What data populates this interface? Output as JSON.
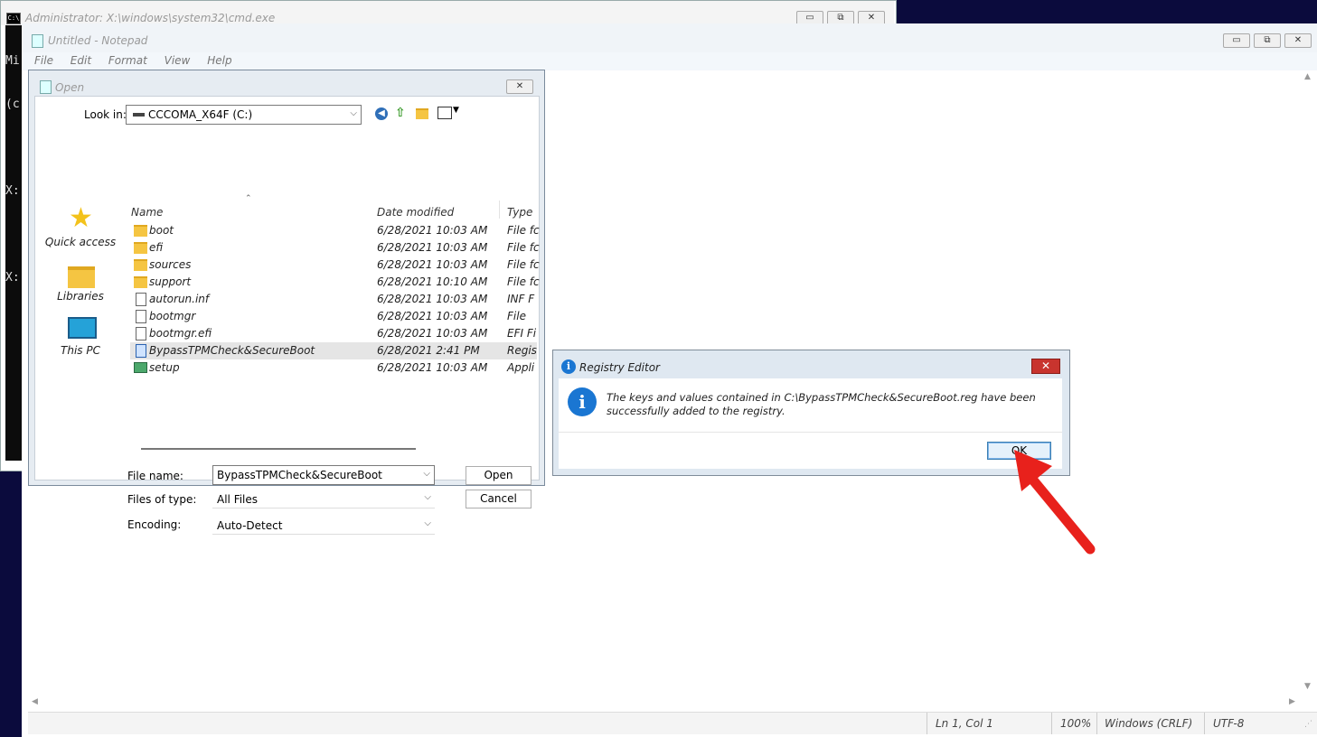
{
  "cmd": {
    "title": "Administrator: X:\\windows\\system32\\cmd.exe",
    "icon_text": "C:\\",
    "console_lines": [
      "Mi",
      "(c",
      "",
      "X:",
      "",
      "X:"
    ],
    "buttons": {
      "minimize": "▭",
      "restore": "⧉",
      "close": "✕"
    }
  },
  "notepad": {
    "title": "Untitled - Notepad",
    "menu": [
      "File",
      "Edit",
      "Format",
      "View",
      "Help"
    ],
    "buttons": {
      "minimize": "▭",
      "restore": "⧉",
      "close": "✕"
    },
    "status": {
      "position": "Ln 1, Col 1",
      "zoom": "100%",
      "line_ending": "Windows (CRLF)",
      "encoding": "UTF-8"
    }
  },
  "open_dialog": {
    "title": "Open",
    "look_in_label": "Look in:",
    "look_in_value": "CCCOMA_X64F (C:)",
    "places": [
      "Quick access",
      "Libraries",
      "This PC"
    ],
    "columns": {
      "name": "Name",
      "date": "Date modified",
      "type": "Type"
    },
    "files": [
      {
        "name": "boot",
        "date": "6/28/2021 10:03 AM",
        "type": "File fc",
        "kind": "folder"
      },
      {
        "name": "efi",
        "date": "6/28/2021 10:03 AM",
        "type": "File fc",
        "kind": "folder"
      },
      {
        "name": "sources",
        "date": "6/28/2021 10:03 AM",
        "type": "File fc",
        "kind": "folder"
      },
      {
        "name": "support",
        "date": "6/28/2021 10:10 AM",
        "type": "File fc",
        "kind": "folder"
      },
      {
        "name": "autorun.inf",
        "date": "6/28/2021 10:03 AM",
        "type": "INF F",
        "kind": "file"
      },
      {
        "name": "bootmgr",
        "date": "6/28/2021 10:03 AM",
        "type": "File",
        "kind": "file"
      },
      {
        "name": "bootmgr.efi",
        "date": "6/28/2021 10:03 AM",
        "type": "EFI Fi",
        "kind": "file"
      },
      {
        "name": "BypassTPMCheck&SecureBoot",
        "date": "6/28/2021 2:41 PM",
        "type": "Regis",
        "kind": "reg"
      },
      {
        "name": "setup",
        "date": "6/28/2021 10:03 AM",
        "type": "Appli",
        "kind": "app"
      }
    ],
    "file_name_label": "File name:",
    "file_name_value": "BypassTPMCheck&SecureBoot",
    "files_of_type_label": "Files of type:",
    "files_of_type_value": "All Files",
    "encoding_label": "Encoding:",
    "encoding_value": "Auto-Detect",
    "open_button": "Open",
    "cancel_button": "Cancel",
    "close_glyph": "✕"
  },
  "registry_dialog": {
    "title": "Registry Editor",
    "message": "The keys and values contained in C:\\BypassTPMCheck&SecureBoot.reg have been successfully added to the registry.",
    "ok_button": "OK",
    "close_glyph": "✕",
    "info_glyph": "i"
  },
  "colors": {
    "arrow": "#e8211c",
    "info_blue": "#1a76d2",
    "close_red": "#c8342e"
  }
}
